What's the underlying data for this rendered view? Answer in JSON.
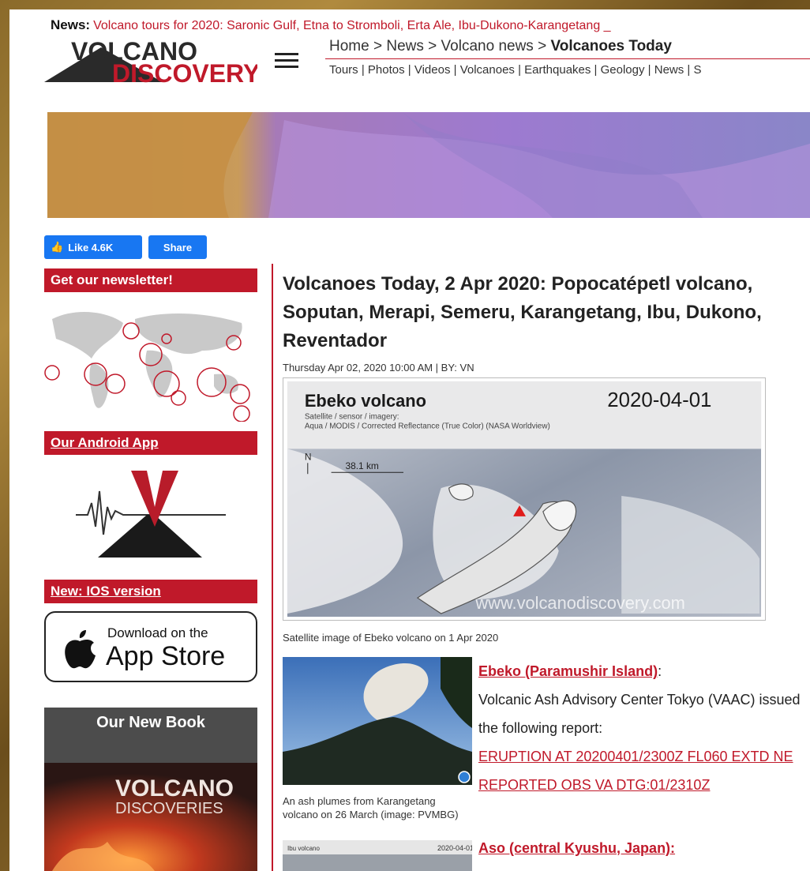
{
  "news": {
    "label": "News:",
    "text": "Volcano tours for 2020: Saronic Gulf, Etna to Stromboli, Erta Ale, Ibu-Dukono-Karangetang _"
  },
  "logo": {
    "line1": "VOLCANO",
    "line2": "DISCOVERY"
  },
  "breadcrumb": {
    "home": "Home",
    "news": "News",
    "volcano_news": "Volcano news",
    "current": "Volcanoes Today",
    "sep": ">"
  },
  "topnav": [
    "Tours",
    "Photos",
    "Videos",
    "Volcanoes",
    "Earthquakes",
    "Geology",
    "News",
    "S"
  ],
  "social": {
    "like": "Like 4.6K",
    "share": "Share"
  },
  "sidebar": {
    "newsletter": "Get our newsletter!",
    "android": "Our Android App",
    "ios": "New: IOS version",
    "appstore_line1": "Download on the",
    "appstore_line2": "App Store",
    "book_title": "Our New Book",
    "book_cover_line1": "VOLCANO",
    "book_cover_line2": "DISCOVERIES"
  },
  "article": {
    "title": "Volcanoes Today, 2 Apr 2020: Popocatépetl volcano, Soputan, Merapi, Semeru, Karangetang, Ibu, Dukono, Reventador",
    "byline": "Thursday Apr 02, 2020 10:00 AM | BY: VN",
    "image": {
      "name": "Ebeko volcano",
      "date": "2020-04-01",
      "sensor_line1": "Satellite / sensor / imagery:",
      "sensor_line2": "Aqua / MODIS / Corrected Reflectance (True Color) (NASA Worldview)",
      "north": "N",
      "scale": "38.1 km",
      "watermark": "www.volcanodiscovery.com"
    },
    "image_caption": "Satellite image of Ebeko volcano on 1 Apr 2020",
    "thumb_caption": "An ash plumes from Karangetang volcano on 26 March (image: PVMBG)",
    "entry1": {
      "name": "Ebeko (Paramushir Island)",
      "colon": ":",
      "text": "Volcanic Ash Advisory Center Tokyo (VAAC) issued the following report:",
      "report": "ERUPTION AT 20200401/2300Z FL060 EXTD NE REPORTED OBS VA DTG:01/2310Z"
    },
    "thumb2": {
      "name": "Ibu volcano",
      "date": "2020-04-01"
    },
    "entry2": "Aso (central Kyushu, Japan):"
  },
  "colors": {
    "accent": "#c0192a",
    "facebook": "#1877f2"
  }
}
